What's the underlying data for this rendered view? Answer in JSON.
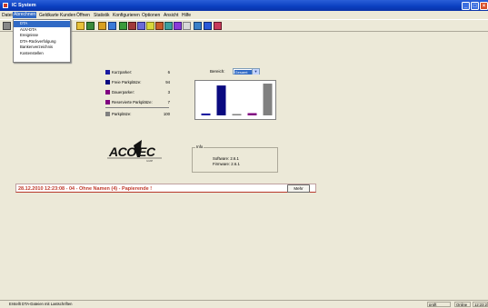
{
  "window": {
    "title": "IC System"
  },
  "menu": [
    "Datei",
    "Abrechnen",
    "Geldkarte",
    "Kunden",
    "Öffnen",
    "Statistik",
    "Konfigurieren",
    "Optionen",
    "Ansicht",
    "Hilfe"
  ],
  "dropdown": [
    "DTA",
    "AUV-DTA",
    "Ereignisse",
    "DTA-Rückverfolgung",
    "Bankenverzeichnis",
    "Kostenstellen"
  ],
  "legend": [
    {
      "label": "Kurzparker:",
      "value": "6",
      "color": "#1a1aa0"
    },
    {
      "label": "Freie Parkplätze:",
      "value": "94",
      "color": "#0a0a80"
    },
    {
      "label": "Dauerparker:",
      "value": "3",
      "color": "#800080"
    },
    {
      "label": "Reservierte Parkplätze:",
      "value": "7",
      "color": "#800080"
    },
    {
      "label": "Parkplätze:",
      "value": "100",
      "color": "#808080"
    }
  ],
  "bereich": {
    "label": "Bereich:",
    "value": "Gesamt"
  },
  "chart_data": {
    "type": "bar",
    "categories": [
      "Kurzparker",
      "Freie Parkplätze",
      "Dauerparker",
      "Reservierte Parkplätze",
      "Parkplätze"
    ],
    "values": [
      6,
      94,
      3,
      7,
      100
    ],
    "colors": [
      "#1a1aa0",
      "#0a0a80",
      "#808080",
      "#800080",
      "#808080"
    ],
    "ylim": [
      0,
      100
    ]
  },
  "info": {
    "title": "Info",
    "software": "Software: 2.6.1",
    "firmware": "Firmware: 2.6.1"
  },
  "logo": {
    "text": "ACOTEC",
    "sub": "GmbH"
  },
  "status": {
    "message": "28.12.2010 12:23:08 - 04 - Ohne Namen (4) - Papierende !",
    "more_label": "Mehr"
  },
  "statusbar": {
    "left": "Erstellt DTA-Dateien mit Lastschriften",
    "p1": "prüft",
    "p2": "Online",
    "clock": "12:23:23"
  }
}
